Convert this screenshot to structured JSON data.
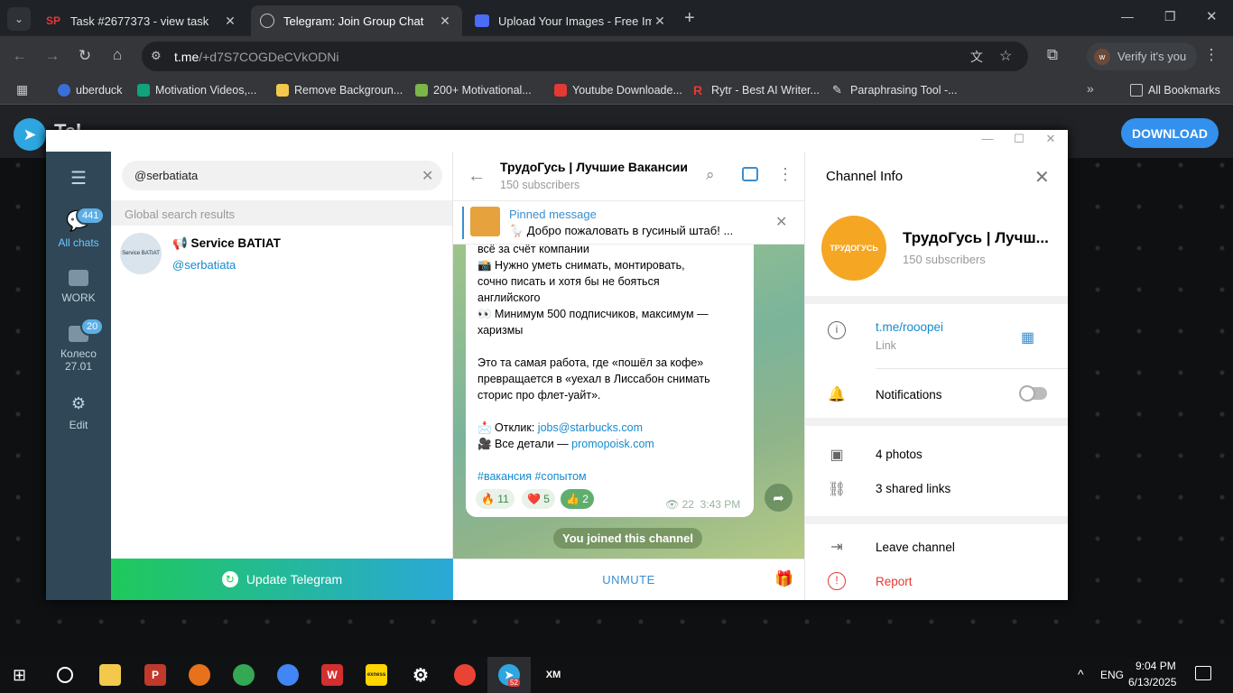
{
  "browser": {
    "tabs": [
      {
        "title": "Task #2677373 - view task",
        "favicon": "SP"
      },
      {
        "title": "Telegram: Join Group Chat",
        "favicon": "globe"
      },
      {
        "title": "Upload Your Images - Free Ima",
        "favicon": "img"
      }
    ],
    "url_domain": "t.me",
    "url_path": "/+d7S7COGDeCVkODNi",
    "verify_label": "Verify it's you",
    "bookmarks": [
      "uberduck",
      "Motivation Videos,...",
      "Remove Backgroun...",
      "200+ Motivational...",
      "Youtube Downloade...",
      "Rytr - Best AI Writer...",
      "Paraphrasing Tool -..."
    ],
    "all_bookmarks": "All Bookmarks"
  },
  "page": {
    "download_label": "DOWNLOAD",
    "header_partial": "Tel"
  },
  "tg": {
    "leftbar": {
      "all_chats": "All chats",
      "all_chats_badge": "441",
      "work": "WORK",
      "koleso": "Колесо",
      "koleso_date": "27.01",
      "koleso_badge": "20",
      "edit": "Edit"
    },
    "search_value": "@serbatiata",
    "global_results": "Global search results",
    "result": {
      "name": "📢 Service BATIAT",
      "handle": "@serbatiata",
      "avatar_text": "Service BATIAT"
    },
    "update_label": "Update Telegram",
    "chat": {
      "title": "ТрудоГусь | Лучшие Вакансии",
      "subscribers": "150 subscribers",
      "pinned_label": "Pinned message",
      "pinned_text": "🪿 Добро пожаловать в гусиный штаб! ...",
      "lines": [
        "всё за счёт компании",
        "📸 Нужно уметь снимать, монтировать,",
        "сочно писать и хотя бы не бояться",
        "английского",
        "👀 Минимум 500 подписчиков, максимум —",
        "харизмы",
        "Это та самая работа, где «пошёл за кофе»",
        "превращается в «уехал в Лиссабон снимать",
        "сторис про флет-уайт»."
      ],
      "apply_prefix": "📩 Отклик: ",
      "apply_link": "jobs@starbucks.com",
      "details_prefix": "🎥 Все детали — ",
      "details_link": "promopoisk.com",
      "hashtags": "#вакансия #сопытом",
      "reactions": [
        {
          "emoji": "🔥",
          "count": "11"
        },
        {
          "emoji": "❤️",
          "count": "5"
        },
        {
          "emoji": "👍",
          "count": "2"
        }
      ],
      "views": "22",
      "time": "3:43 PM",
      "joined": "You joined this channel",
      "unmute": "UNMUTE"
    },
    "info": {
      "header": "Channel Info",
      "name": "ТрудоГусь | Лучш...",
      "subscribers": "150 subscribers",
      "link": "t.me/rooopei",
      "link_label": "Link",
      "notifications": "Notifications",
      "notifications_on": false,
      "photos": "4 photos",
      "links": "3 shared links",
      "leave": "Leave channel",
      "report": "Report",
      "avatar_text": "ТРУДОГУСЬ"
    }
  },
  "taskbar": {
    "lang": "ENG",
    "time": "9:04 PM",
    "date": "6/13/2025",
    "telegram_badge": "52"
  },
  "colors": {
    "accent": "#3390ec",
    "sidebar": "#2f4756",
    "link": "#168acd",
    "report": "#e53935"
  }
}
